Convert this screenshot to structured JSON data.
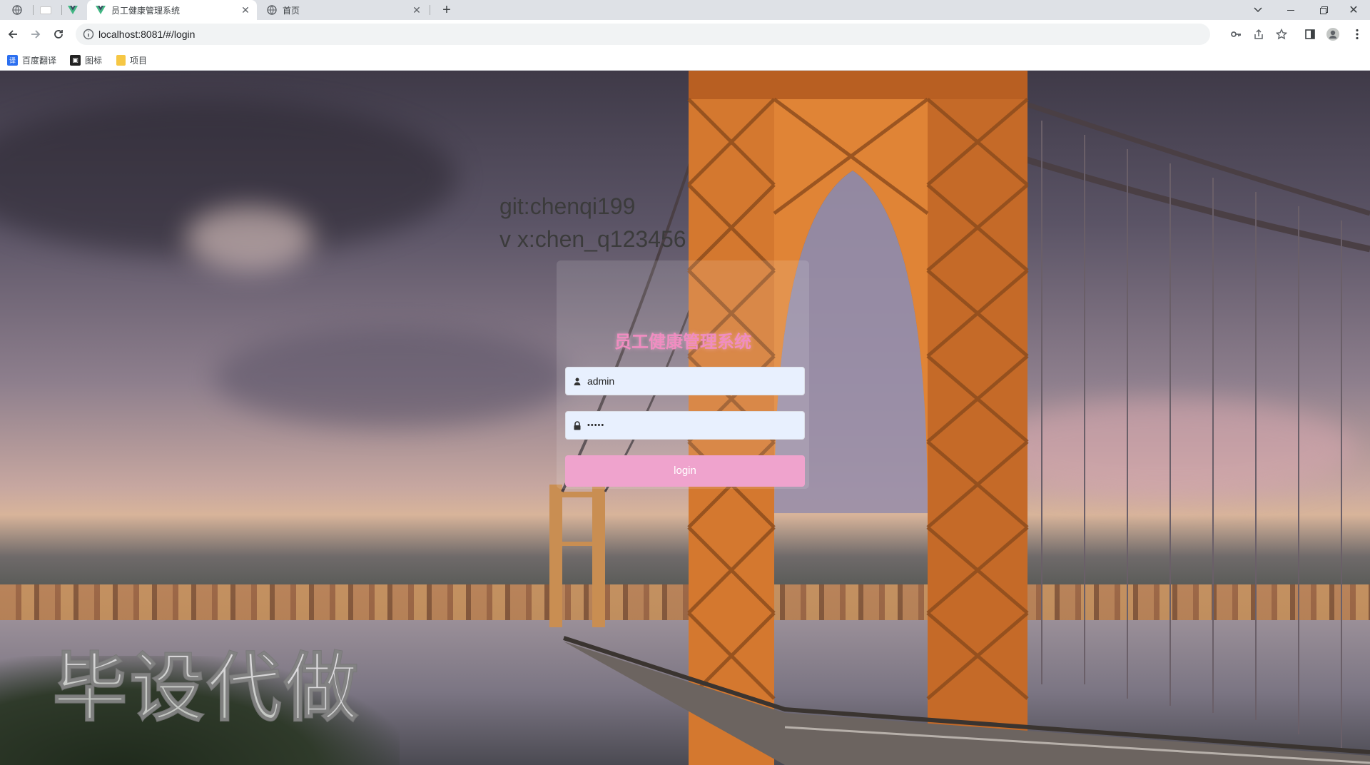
{
  "browser": {
    "tabs": [
      {
        "title": "",
        "pinned": true
      },
      {
        "title": "",
        "pinned": true
      },
      {
        "title": "",
        "pinned": true,
        "icon": "vue-logo-icon"
      },
      {
        "title": "员工健康管理系统",
        "active": true,
        "icon": "vue-logo-icon"
      },
      {
        "title": "首页",
        "icon": "globe-icon"
      }
    ],
    "url": "localhost:8081/#/login",
    "bookmarks": [
      {
        "label": "百度翻译",
        "icon": "translate-icon",
        "color": "#2b6ff0"
      },
      {
        "label": "图标",
        "icon": "image-icon",
        "color": "#222222"
      },
      {
        "label": "项目",
        "icon": "folder-icon",
        "color": "#f6c744"
      }
    ]
  },
  "page": {
    "overlay_lines": [
      "git:chenqi199",
      "v x:chen_q123456"
    ],
    "watermark": "毕设代做",
    "login": {
      "title": "员工健康管理系统",
      "username": "admin",
      "password_mask": "•••••",
      "button_label": "login",
      "accent_color": "#efa3cd"
    }
  }
}
